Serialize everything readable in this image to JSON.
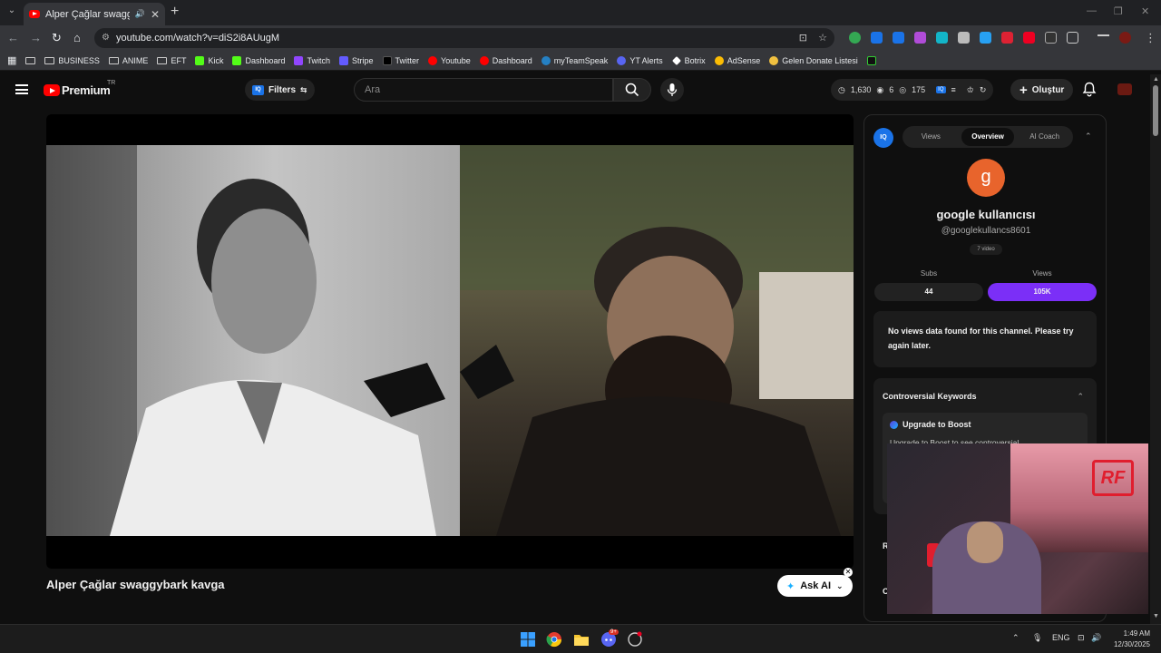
{
  "browser": {
    "tab_title": "Alper Çağlar swaggybark k",
    "url": "youtube.com/watch?v=diS2i8AUugM",
    "bookmarks": [
      {
        "label": "",
        "icon": "folder-icon"
      },
      {
        "label": "BUSINESS",
        "icon": "folder-icon"
      },
      {
        "label": "ANIME",
        "icon": "folder-icon"
      },
      {
        "label": "EFT",
        "icon": "folder-icon"
      },
      {
        "label": "Kick",
        "icon": "kick-icon",
        "color": "#53fc18"
      },
      {
        "label": "Dashboard",
        "icon": "kick-icon",
        "color": "#53fc18"
      },
      {
        "label": "Twitch",
        "icon": "twitch-icon",
        "color": "#9146ff"
      },
      {
        "label": "Stripe",
        "icon": "stripe-icon",
        "color": "#635bff"
      },
      {
        "label": "Twitter",
        "icon": "x-icon",
        "color": "#000000"
      },
      {
        "label": "Youtube",
        "icon": "youtube-icon",
        "color": "#ff0000"
      },
      {
        "label": "Dashboard",
        "icon": "youtube-icon",
        "color": "#ff0000"
      },
      {
        "label": "myTeamSpeak",
        "icon": "teamspeak-icon",
        "color": "#2580c3"
      },
      {
        "label": "YT Alerts",
        "icon": "discord-icon",
        "color": "#5865f2"
      },
      {
        "label": "Botrix",
        "icon": "botrix-icon",
        "color": "#ffffff"
      },
      {
        "label": "AdSense",
        "icon": "adsense-icon",
        "color": "#fbbc04"
      },
      {
        "label": "Gelen Donate Listesi",
        "icon": "donate-icon",
        "color": "#f0c040"
      }
    ]
  },
  "youtube": {
    "logo_text": "Premium",
    "country": "TR",
    "filters_label": "Filters",
    "search_placeholder": "Ara",
    "stats": {
      "time": "1,630",
      "eye": "6",
      "views": "175"
    },
    "create_label": "Oluştur",
    "video_title": "Alper Çağlar swaggybark kavga",
    "ask_ai_label": "Ask AI"
  },
  "panel": {
    "logo": "IQ",
    "tabs": [
      "Views",
      "Overview",
      "AI Coach"
    ],
    "active_tab": "Overview",
    "channel_initial": "g",
    "channel_name": "google kullanıcısı",
    "channel_handle": "@googlekullancs8601",
    "channel_videos": "7 video",
    "subs_label": "Subs",
    "subs_value": "44",
    "views_label": "Views",
    "views_value": "105K",
    "no_data_text": "No views data found for this channel. Please try again later.",
    "controversial_title": "Controversial Keywords",
    "upgrade_title": "Upgrade to Boost",
    "upgrade_text": "Upgrade to Boost to see controversial",
    "section_r": "R",
    "section_c": "C",
    "accent": "#7b2ff7"
  },
  "taskbar": {
    "lang": "ENG",
    "time": "1:49 AM",
    "date": "12/30/2025",
    "discord_badge": "9+"
  }
}
